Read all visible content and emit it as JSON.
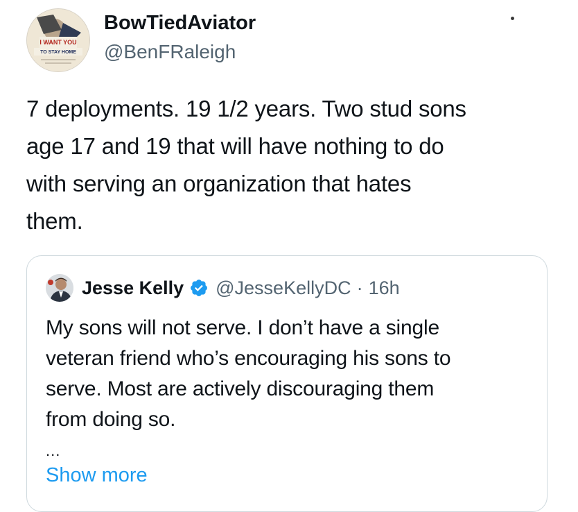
{
  "author": {
    "display_name": "BowTiedAviator",
    "handle": "@BenFRaleigh",
    "avatar_text": "I WANT YOU TO STAY HOME"
  },
  "tweet": {
    "lines": [
      "7 deployments. 19 1/2 years. Two stud sons",
      "age 17 and 19 that will have nothing to do",
      "with serving an organization that hates",
      "them."
    ]
  },
  "quoted": {
    "display_name": "Jesse Kelly",
    "handle": "@JesseKellyDC",
    "separator": "·",
    "time": "16h",
    "lines": [
      "My sons will not serve. I don’t have a single",
      "veteran friend who’s encouraging his sons to",
      "serve. Most are actively discouraging them",
      "from doing so."
    ],
    "ellipsis": "...",
    "show_more": "Show more"
  },
  "colors": {
    "link": "#1d9bf0",
    "secondary_text": "#536471",
    "verified_badge": "#1d9bf0",
    "border": "#cfd9de"
  },
  "icons": {
    "verified": "verified-badge-icon",
    "more": "more-options-icon"
  }
}
